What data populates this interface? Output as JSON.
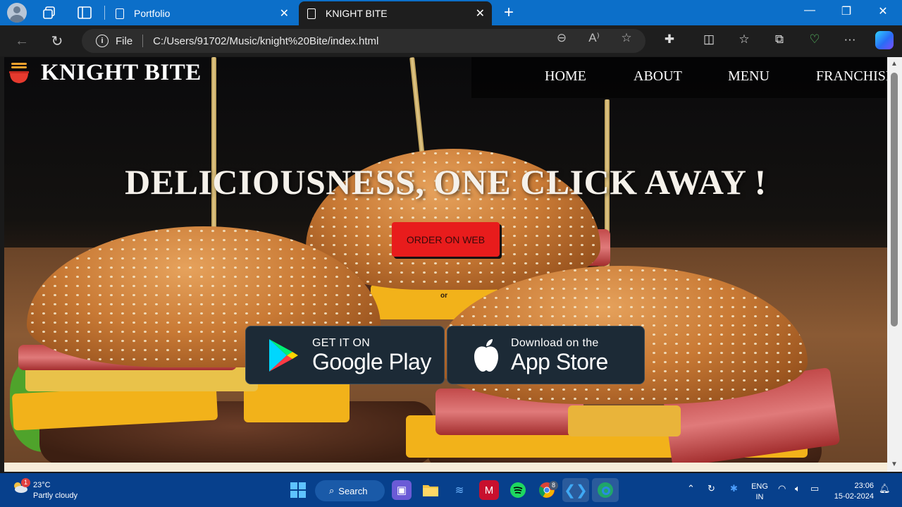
{
  "browser": {
    "tabs": [
      {
        "title": "Portfolio",
        "active": false
      },
      {
        "title": "KNIGHT BITE",
        "active": true
      }
    ],
    "address": {
      "scheme_label": "File",
      "url": "C:/Users/91702/Music/knight%20Bite/index.html"
    },
    "icons": {
      "back": "←",
      "reload": "↻",
      "zoom": "⊖",
      "read_aloud": "A⁾",
      "favorite": "☆",
      "extensions": "✚",
      "split": "◫",
      "favorites": "☆",
      "collections": "⧉",
      "health": "♡",
      "more": "···",
      "new_tab": "+",
      "close": "✕",
      "minimize": "—",
      "restore": "❐",
      "close_window": "✕"
    }
  },
  "site": {
    "brand": "KNIGHT BITE",
    "nav": [
      "HOME",
      "ABOUT",
      "MENU",
      "FRANCHISE"
    ],
    "headline": "DELICIOUSNESS, ONE CLICK AWAY !",
    "order_button": "ORDER ON WEB",
    "or_text": "or",
    "google_play": {
      "small": "GET IT ON",
      "big": "Google Play"
    },
    "app_store": {
      "small": "Download on the",
      "big": "App Store"
    },
    "accent_color": "#e81c1c"
  },
  "taskbar": {
    "weather": {
      "temp": "23°C",
      "desc": "Partly cloudy",
      "badge": "1"
    },
    "search_label": "Search",
    "lang": {
      "line1": "ENG",
      "line2": "IN"
    },
    "clock": {
      "time": "23:06",
      "date": "15-02-2024"
    },
    "chrome_badge": "8"
  }
}
